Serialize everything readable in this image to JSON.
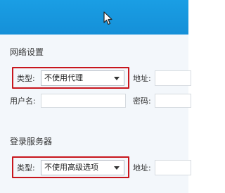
{
  "proxy_section": {
    "title": "网络设置",
    "type_label": "类型:",
    "type_value": "不使用代理",
    "address_label": "地址:",
    "username_label": "用户名:",
    "password_label": "密码:"
  },
  "server_section": {
    "title": "登录服务器",
    "type_label": "类型:",
    "type_value": "不使用高级选项",
    "address_label": "地址:"
  },
  "colors": {
    "header": "#1a9ee4",
    "panel": "#f3f7fb",
    "highlight": "#c8161d"
  }
}
